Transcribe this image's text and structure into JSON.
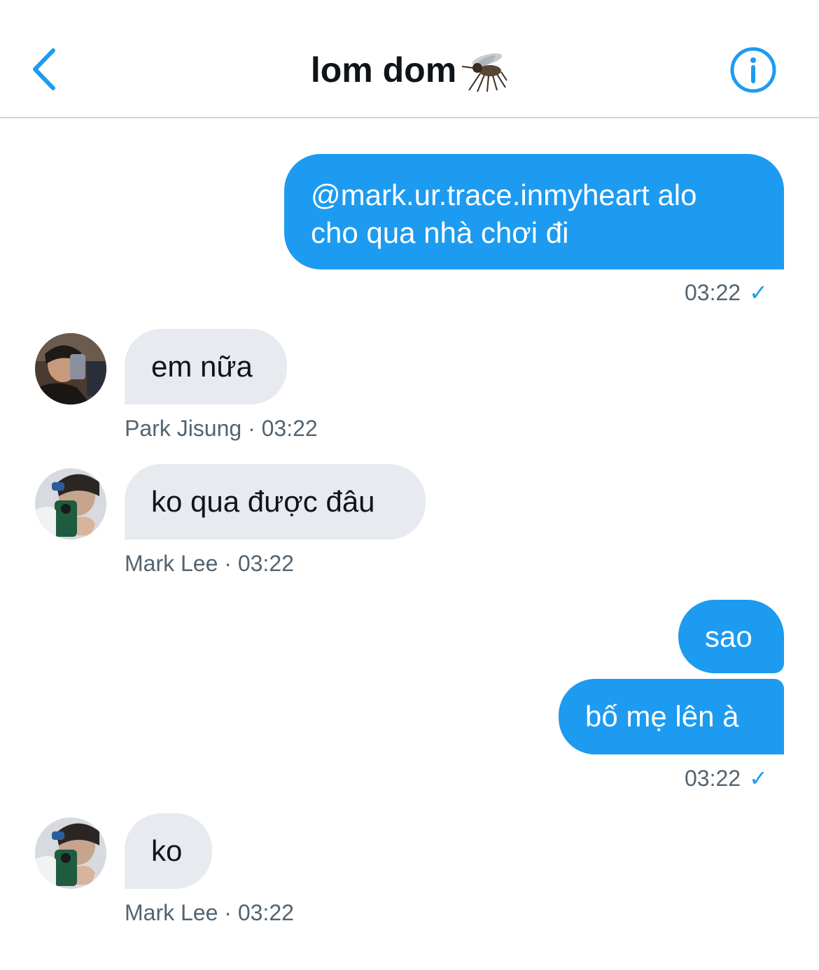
{
  "header": {
    "title": "lom dom",
    "title_emoji": "mosquito-icon",
    "back_icon": "chevron-left-icon",
    "info_icon": "info-icon",
    "accent_color": "#1d9bf0"
  },
  "messages": [
    {
      "direction": "out",
      "text_line1": "@mark.ur.trace.inmyheart alo",
      "text_line2": "cho qua nhà chơi đi",
      "time": "03:22",
      "read_icon": "✓"
    },
    {
      "direction": "in",
      "sender": "Park Jisung",
      "text": "em nữa",
      "time": "03:22",
      "meta": "Park Jisung · 03:22"
    },
    {
      "direction": "in",
      "sender": "Mark Lee",
      "text": "ko qua được đâu",
      "time": "03:22",
      "meta": "Mark Lee · 03:22"
    },
    {
      "direction": "out",
      "text": "sao"
    },
    {
      "direction": "out",
      "text": "bố mẹ lên à",
      "time": "03:22",
      "read_icon": "✓"
    },
    {
      "direction": "in",
      "sender": "Mark Lee",
      "text": "ko",
      "time": "03:22",
      "meta": "Mark Lee · 03:22"
    }
  ],
  "colors": {
    "outgoing_bubble": "#1d9bf0",
    "incoming_bubble": "#e7eaef",
    "meta_text": "#536471"
  }
}
